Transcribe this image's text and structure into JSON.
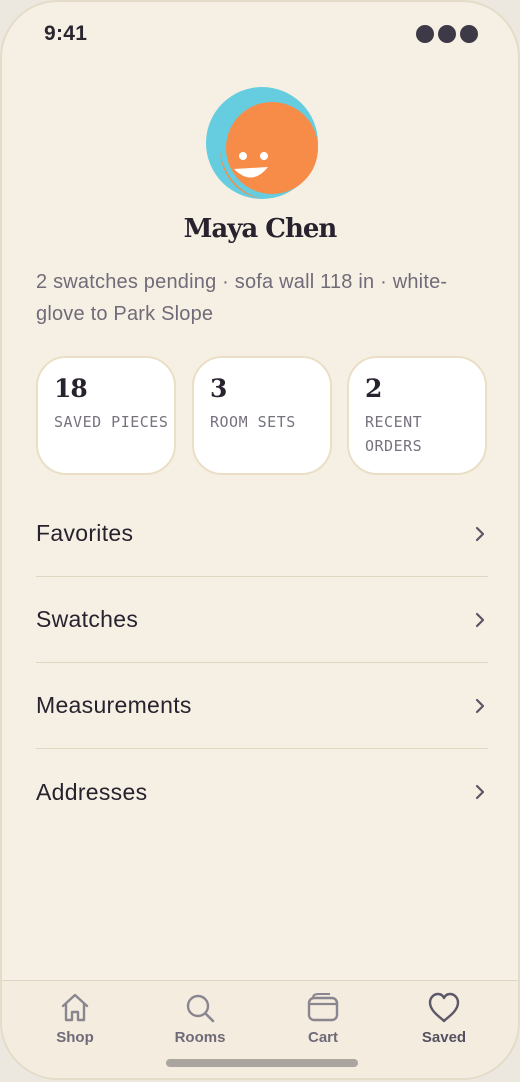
{
  "status_bar": {
    "time": "9:41"
  },
  "profile": {
    "name": "Maya Chen",
    "subtitle": "2 swatches pending · sofa wall 118 in · white-glove to Park Slope",
    "avatar_colors": {
      "back": "#66cde0",
      "front": "#f78c48",
      "smile": "#ffffff"
    }
  },
  "stats": [
    {
      "value": "18",
      "label": "SAVED PIECES"
    },
    {
      "value": "3",
      "label": "ROOM SETS"
    },
    {
      "value": "2",
      "label": "RECENT ORDERS"
    }
  ],
  "menu": [
    {
      "label": "Favorites",
      "icon": "chevron-right-icon"
    },
    {
      "label": "Swatches",
      "icon": "chevron-right-icon"
    },
    {
      "label": "Measurements",
      "icon": "chevron-right-icon"
    },
    {
      "label": "Addresses",
      "icon": "chevron-right-icon"
    }
  ],
  "tabbar": {
    "tabs": [
      {
        "label": "Shop",
        "icon": "home-icon"
      },
      {
        "label": "Rooms",
        "icon": "search-icon"
      },
      {
        "label": "Cart",
        "icon": "wallet-icon"
      },
      {
        "label": "Saved",
        "icon": "heart-icon",
        "active": true
      }
    ]
  },
  "colors": {
    "background": "#f6f0e4",
    "card": "#ffffff",
    "card_border": "#eadfc6",
    "text_primary": "#27222e",
    "text_secondary": "#706b78"
  }
}
